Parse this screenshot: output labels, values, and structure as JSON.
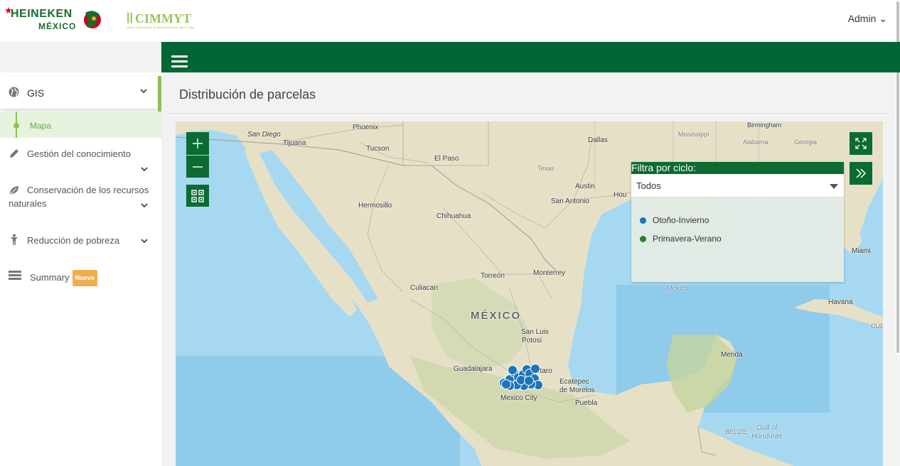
{
  "header": {
    "logo_brand": "HEINEKEN",
    "logo_brand_sub": "MÉXICO",
    "logo_partner": "CIMMYT",
    "logo_partner_sub": "Centro Internacional de Mejoramiento de Maíz y Trigo",
    "user_menu": "Admin ⌄"
  },
  "sidebar": {
    "items": [
      {
        "label": "GIS",
        "icon": "globe-icon",
        "expanded": true,
        "active": true
      },
      {
        "label": "Mapa",
        "icon": "dot-icon",
        "active": true
      },
      {
        "label": "Gestión del conocimiento",
        "icon": "pencil-icon"
      },
      {
        "label": "Conservación de los recursos naturales",
        "icon": "leaf-icon"
      },
      {
        "label": "Reducción de pobreza",
        "icon": "person-icon"
      },
      {
        "label": "Summary",
        "icon": "list-icon",
        "badge": "Nuevo"
      }
    ]
  },
  "main": {
    "title": "Distribución de parcelas"
  },
  "map": {
    "filter_title": "Filtra por ciclo:",
    "filter_value": "Todos",
    "legend": [
      {
        "label": "Otoño-Invierno",
        "color": "#1b75bb"
      },
      {
        "label": "Primavera-Verano",
        "color": "#2e7d32"
      }
    ],
    "labels": {
      "san_diego": "San Diego",
      "tijuana": "Tijuana",
      "phoenix": "Phoenix",
      "tucson": "Tucson",
      "el_paso": "El Paso",
      "dallas": "Dallas",
      "texas": "Texas",
      "austin": "Austin",
      "san_antonio": "San Antonio",
      "houston": "Hou",
      "hermosillo": "Hermosillo",
      "chihuahua": "Chihuahua",
      "torreon": "Torreón",
      "monterrey": "Monterrey",
      "culiacan": "Culiacan",
      "mexico": "MÉXICO",
      "san_luis": "San Luis",
      "potosi": "Potosí",
      "guadalajara": "Guadalajara",
      "queretaro": "etaro",
      "ecatepec": "Ecatepec",
      "de_morelos": "de Morelos",
      "mexico_city": "Mexico City",
      "puebla": "Puebla",
      "merida": "Merida",
      "havana": "Havana",
      "cuba": "CUB",
      "miami": "Miami",
      "mexico_gulf": "Mexico",
      "birmingham": "Birmingham",
      "mississippi": "Mississippi",
      "alabama": "Alabama",
      "georgia": "Georgia",
      "belize": "BELIZE",
      "gulf_honduras": "Gulf of",
      "honduras": "Honduras"
    },
    "marker_color": "#1b75bb"
  }
}
